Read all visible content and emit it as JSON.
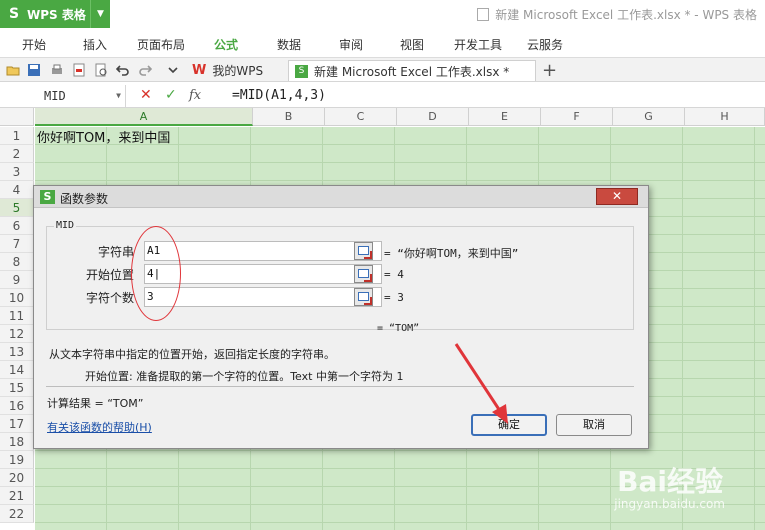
{
  "app": {
    "name": "WPS 表格",
    "logo_letter": "S",
    "window_title": "新建 Microsoft Excel 工作表.xlsx * - WPS 表格"
  },
  "menu": [
    "开始",
    "插入",
    "页面布局",
    "公式",
    "数据",
    "审阅",
    "视图",
    "开发工具",
    "云服务"
  ],
  "menu_active": "公式",
  "tabs": {
    "home_label": "我的WPS",
    "doc_label": "新建 Microsoft Excel 工作表.xlsx *",
    "add_label": "+"
  },
  "formula_bar": {
    "name_box": "MID",
    "formula": "=MID(A1,4,3)",
    "fx_label": "fx"
  },
  "sheet": {
    "columns": [
      "A",
      "B",
      "C",
      "D",
      "E",
      "F",
      "G",
      "H"
    ],
    "rows": [
      "1",
      "2",
      "3",
      "4",
      "5",
      "6",
      "7",
      "8",
      "9",
      "10",
      "11",
      "12",
      "13",
      "14",
      "15",
      "16",
      "17",
      "18",
      "19",
      "20",
      "21",
      "22"
    ],
    "selected_row": "5",
    "selected_col": "A",
    "a1_value": "你好啊TOM，来到中国"
  },
  "dialog": {
    "title": "函数参数",
    "function_name": "MID",
    "args": [
      {
        "label": "字符串",
        "value": "A1",
        "result": "= “你好啊TOM，来到中国”"
      },
      {
        "label": "开始位置",
        "value": "4|",
        "result": "= 4"
      },
      {
        "label": "字符个数",
        "value": "3",
        "result": "= 3"
      }
    ],
    "result_preview": "= “TOM”",
    "description": "从文本字符串中指定的位置开始，返回指定长度的字符串。",
    "arg_description": "开始位置:  准备提取的第一个字符的位置。Text 中第一个字符为 1",
    "calc_result": "计算结果 = “TOM”",
    "help_link": "有关该函数的帮助(H)",
    "ok_label": "确定",
    "cancel_label": "取消",
    "close_label": "✕"
  },
  "watermark": {
    "text": "Bai经验",
    "url_text": "jingyan.baidu.com"
  },
  "colors": {
    "accent": "#4aa843",
    "sheet_bg": "#cfe8c8",
    "annotation": "#e0353a"
  }
}
